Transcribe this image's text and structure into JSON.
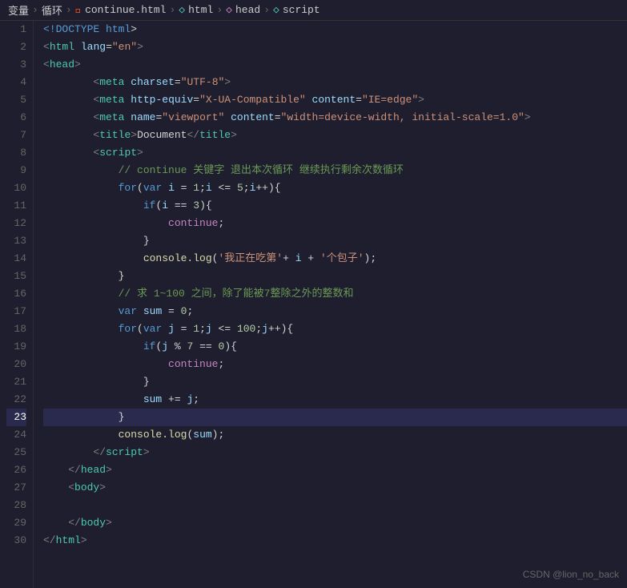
{
  "breadcrumb": {
    "items": [
      "变量",
      "循环",
      "continue.html",
      "html",
      "head",
      "script"
    ]
  },
  "editor": {
    "active_line": 23,
    "lines": [
      {
        "num": 1,
        "tokens": [
          {
            "t": "kw",
            "v": "<!DOCTYPE"
          },
          {
            "t": "plain",
            "v": " "
          },
          {
            "t": "kw",
            "v": "html"
          },
          {
            "t": "plain",
            "v": ">"
          }
        ]
      },
      {
        "num": 2,
        "tokens": [
          {
            "t": "gt-lt",
            "v": "<"
          },
          {
            "t": "tag",
            "v": "html"
          },
          {
            "t": "plain",
            "v": " "
          },
          {
            "t": "attr",
            "v": "lang"
          },
          {
            "t": "plain",
            "v": "="
          },
          {
            "t": "val",
            "v": "\"en\""
          },
          {
            "t": "gt-lt",
            "v": ">"
          }
        ]
      },
      {
        "num": 3,
        "tokens": [
          {
            "t": "gt-lt",
            "v": "<"
          },
          {
            "t": "tag",
            "v": "head"
          },
          {
            "t": "gt-lt",
            "v": ">"
          }
        ]
      },
      {
        "num": 4,
        "tokens": [
          {
            "t": "plain",
            "v": "        "
          },
          {
            "t": "gt-lt",
            "v": "<"
          },
          {
            "t": "tag",
            "v": "meta"
          },
          {
            "t": "plain",
            "v": " "
          },
          {
            "t": "attr",
            "v": "charset"
          },
          {
            "t": "plain",
            "v": "="
          },
          {
            "t": "val",
            "v": "\"UTF-8\""
          },
          {
            "t": "gt-lt",
            "v": ">"
          }
        ]
      },
      {
        "num": 5,
        "tokens": [
          {
            "t": "plain",
            "v": "        "
          },
          {
            "t": "gt-lt",
            "v": "<"
          },
          {
            "t": "tag",
            "v": "meta"
          },
          {
            "t": "plain",
            "v": " "
          },
          {
            "t": "attr",
            "v": "http-equiv"
          },
          {
            "t": "plain",
            "v": "="
          },
          {
            "t": "val",
            "v": "\"X-UA-Compatible\""
          },
          {
            "t": "plain",
            "v": " "
          },
          {
            "t": "attr",
            "v": "content"
          },
          {
            "t": "plain",
            "v": "="
          },
          {
            "t": "val",
            "v": "\"IE=edge\""
          },
          {
            "t": "gt-lt",
            "v": ">"
          }
        ]
      },
      {
        "num": 6,
        "tokens": [
          {
            "t": "plain",
            "v": "        "
          },
          {
            "t": "gt-lt",
            "v": "<"
          },
          {
            "t": "tag",
            "v": "meta"
          },
          {
            "t": "plain",
            "v": " "
          },
          {
            "t": "attr",
            "v": "name"
          },
          {
            "t": "plain",
            "v": "="
          },
          {
            "t": "val",
            "v": "\"viewport\""
          },
          {
            "t": "plain",
            "v": " "
          },
          {
            "t": "attr",
            "v": "content"
          },
          {
            "t": "plain",
            "v": "="
          },
          {
            "t": "val",
            "v": "\"width=device-width, initial-scale=1.0\""
          },
          {
            "t": "gt-lt",
            "v": ">"
          }
        ]
      },
      {
        "num": 7,
        "tokens": [
          {
            "t": "plain",
            "v": "        "
          },
          {
            "t": "gt-lt",
            "v": "<"
          },
          {
            "t": "tag",
            "v": "title"
          },
          {
            "t": "gt-lt",
            "v": ">"
          },
          {
            "t": "plain",
            "v": "Document"
          },
          {
            "t": "gt-lt",
            "v": "</"
          },
          {
            "t": "tag",
            "v": "title"
          },
          {
            "t": "gt-lt",
            "v": ">"
          }
        ]
      },
      {
        "num": 8,
        "tokens": [
          {
            "t": "plain",
            "v": "        "
          },
          {
            "t": "gt-lt",
            "v": "<"
          },
          {
            "t": "tag",
            "v": "script"
          },
          {
            "t": "gt-lt",
            "v": ">"
          }
        ]
      },
      {
        "num": 9,
        "tokens": [
          {
            "t": "plain",
            "v": "            "
          },
          {
            "t": "comment",
            "v": "// continue 关键字 退出本次循环 继续执行剩余次数循环"
          }
        ]
      },
      {
        "num": 10,
        "tokens": [
          {
            "t": "plain",
            "v": "            "
          },
          {
            "t": "kw",
            "v": "for"
          },
          {
            "t": "plain",
            "v": "("
          },
          {
            "t": "kw",
            "v": "var"
          },
          {
            "t": "plain",
            "v": " "
          },
          {
            "t": "var",
            "v": "i"
          },
          {
            "t": "plain",
            "v": " = "
          },
          {
            "t": "num",
            "v": "1"
          },
          {
            "t": "plain",
            "v": ";"
          },
          {
            "t": "var",
            "v": "i"
          },
          {
            "t": "plain",
            "v": " <= "
          },
          {
            "t": "num",
            "v": "5"
          },
          {
            "t": "plain",
            "v": ";"
          },
          {
            "t": "var",
            "v": "i"
          },
          {
            "t": "plain",
            "v": "++){"
          }
        ]
      },
      {
        "num": 11,
        "tokens": [
          {
            "t": "plain",
            "v": "                "
          },
          {
            "t": "kw",
            "v": "if"
          },
          {
            "t": "plain",
            "v": "("
          },
          {
            "t": "var",
            "v": "i"
          },
          {
            "t": "plain",
            "v": " == "
          },
          {
            "t": "num",
            "v": "3"
          },
          {
            "t": "plain",
            "v": "){"
          }
        ]
      },
      {
        "num": 12,
        "tokens": [
          {
            "t": "plain",
            "v": "                    "
          },
          {
            "t": "kw2",
            "v": "continue"
          },
          {
            "t": "plain",
            "v": ";"
          }
        ]
      },
      {
        "num": 13,
        "tokens": [
          {
            "t": "plain",
            "v": "                }"
          }
        ]
      },
      {
        "num": 14,
        "tokens": [
          {
            "t": "plain",
            "v": "                "
          },
          {
            "t": "fn",
            "v": "console.log"
          },
          {
            "t": "plain",
            "v": "("
          },
          {
            "t": "str",
            "v": "'我正在吃第'"
          },
          {
            "t": "plain",
            "v": "+ "
          },
          {
            "t": "var",
            "v": "i"
          },
          {
            "t": "plain",
            "v": " + "
          },
          {
            "t": "str",
            "v": "'个包子'"
          },
          {
            "t": "plain",
            "v": ");"
          }
        ]
      },
      {
        "num": 15,
        "tokens": [
          {
            "t": "plain",
            "v": "            }"
          }
        ]
      },
      {
        "num": 16,
        "tokens": [
          {
            "t": "plain",
            "v": "            "
          },
          {
            "t": "comment",
            "v": "// 求 1~100 之间，除了能被7整除之外的整数和"
          }
        ]
      },
      {
        "num": 17,
        "tokens": [
          {
            "t": "plain",
            "v": "            "
          },
          {
            "t": "kw",
            "v": "var"
          },
          {
            "t": "plain",
            "v": " "
          },
          {
            "t": "var",
            "v": "sum"
          },
          {
            "t": "plain",
            "v": " = "
          },
          {
            "t": "num",
            "v": "0"
          },
          {
            "t": "plain",
            "v": ";"
          }
        ]
      },
      {
        "num": 18,
        "tokens": [
          {
            "t": "plain",
            "v": "            "
          },
          {
            "t": "kw",
            "v": "for"
          },
          {
            "t": "plain",
            "v": "("
          },
          {
            "t": "kw",
            "v": "var"
          },
          {
            "t": "plain",
            "v": " "
          },
          {
            "t": "var",
            "v": "j"
          },
          {
            "t": "plain",
            "v": " = "
          },
          {
            "t": "num",
            "v": "1"
          },
          {
            "t": "plain",
            "v": ";"
          },
          {
            "t": "var",
            "v": "j"
          },
          {
            "t": "plain",
            "v": " <= "
          },
          {
            "t": "num",
            "v": "100"
          },
          {
            "t": "plain",
            "v": ";"
          },
          {
            "t": "var",
            "v": "j"
          },
          {
            "t": "plain",
            "v": "++){"
          }
        ]
      },
      {
        "num": 19,
        "tokens": [
          {
            "t": "plain",
            "v": "                "
          },
          {
            "t": "kw",
            "v": "if"
          },
          {
            "t": "plain",
            "v": "("
          },
          {
            "t": "var",
            "v": "j"
          },
          {
            "t": "plain",
            "v": " % "
          },
          {
            "t": "num",
            "v": "7"
          },
          {
            "t": "plain",
            "v": " == "
          },
          {
            "t": "num",
            "v": "0"
          },
          {
            "t": "plain",
            "v": "){"
          }
        ]
      },
      {
        "num": 20,
        "tokens": [
          {
            "t": "plain",
            "v": "                    "
          },
          {
            "t": "kw2",
            "v": "continue"
          },
          {
            "t": "plain",
            "v": ";"
          }
        ]
      },
      {
        "num": 21,
        "tokens": [
          {
            "t": "plain",
            "v": "                }"
          }
        ]
      },
      {
        "num": 22,
        "tokens": [
          {
            "t": "plain",
            "v": "                "
          },
          {
            "t": "var",
            "v": "sum"
          },
          {
            "t": "plain",
            "v": " += "
          },
          {
            "t": "var",
            "v": "j"
          },
          {
            "t": "plain",
            "v": ";"
          }
        ]
      },
      {
        "num": 23,
        "tokens": [
          {
            "t": "plain",
            "v": "            }"
          }
        ]
      },
      {
        "num": 24,
        "tokens": [
          {
            "t": "plain",
            "v": "            "
          },
          {
            "t": "fn",
            "v": "console.log"
          },
          {
            "t": "plain",
            "v": "("
          },
          {
            "t": "var",
            "v": "sum"
          },
          {
            "t": "plain",
            "v": ");"
          }
        ]
      },
      {
        "num": 25,
        "tokens": [
          {
            "t": "plain",
            "v": "        "
          },
          {
            "t": "gt-lt",
            "v": "</"
          },
          {
            "t": "tag",
            "v": "script"
          },
          {
            "t": "gt-lt",
            "v": ">"
          }
        ]
      },
      {
        "num": 26,
        "tokens": [
          {
            "t": "plain",
            "v": "    "
          },
          {
            "t": "gt-lt",
            "v": "</"
          },
          {
            "t": "tag",
            "v": "head"
          },
          {
            "t": "gt-lt",
            "v": ">"
          }
        ]
      },
      {
        "num": 27,
        "tokens": [
          {
            "t": "plain",
            "v": "    "
          },
          {
            "t": "gt-lt",
            "v": "<"
          },
          {
            "t": "tag",
            "v": "body"
          },
          {
            "t": "gt-lt",
            "v": ">"
          }
        ]
      },
      {
        "num": 28,
        "tokens": []
      },
      {
        "num": 29,
        "tokens": [
          {
            "t": "plain",
            "v": "    "
          },
          {
            "t": "gt-lt",
            "v": "</"
          },
          {
            "t": "tag",
            "v": "body"
          },
          {
            "t": "gt-lt",
            "v": ">"
          }
        ]
      },
      {
        "num": 30,
        "tokens": [
          {
            "t": "gt-lt",
            "v": "</"
          },
          {
            "t": "tag",
            "v": "html"
          },
          {
            "t": "gt-lt",
            "v": ">"
          }
        ]
      }
    ]
  },
  "watermark": {
    "text": "CSDN @lion_no_back"
  }
}
